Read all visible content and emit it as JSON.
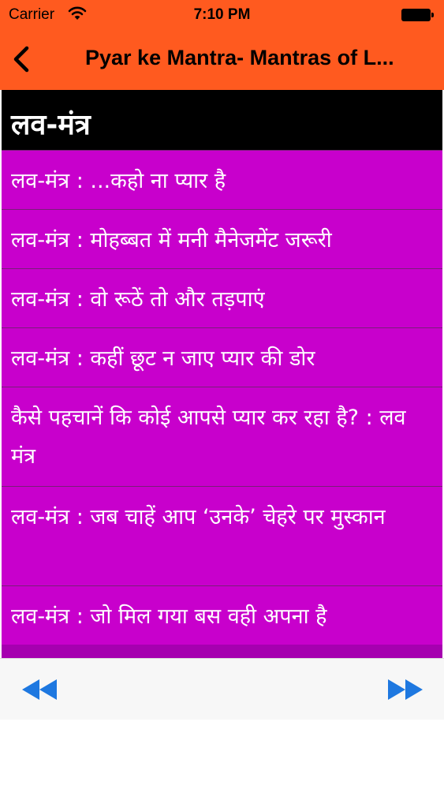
{
  "status_bar": {
    "carrier": "Carrier",
    "time": "7:10 PM",
    "wifi_icon": "wifi-icon",
    "battery_icon": "battery-icon"
  },
  "nav": {
    "title": "Pyar ke Mantra- Mantras of L...",
    "back_icon": "chevron-left-icon"
  },
  "section": {
    "header": "लव-मंत्र"
  },
  "items": [
    {
      "label": "लव-मंत्र : ...कहो ना प्यार है"
    },
    {
      "label": "लव-मंत्र : मोहब्बत में मनी मैनेजमेंट जरूरी"
    },
    {
      "label": "लव-मंत्र : वो रूठें तो और तड़पाएं"
    },
    {
      "label": "लव-मंत्र : कहीं छूट न जाए प्यार की डोर"
    },
    {
      "label": "कैसे पहचानें कि कोई आपसे प्यार कर रहा है? : लव मंत्र"
    },
    {
      "label": "लव-मंत्र : जब चाहें आप ‘उनके’ चेहरे पर मुस्कान"
    },
    {
      "label": "लव-मंत्र : जो मिल गया बस वही अपना है"
    }
  ],
  "bottom_bar": {
    "prev_icon": "rewind-icon",
    "next_icon": "fast-forward-icon"
  },
  "colors": {
    "nav_background": "#ff5a1f",
    "header_background": "#000000",
    "item_background": "#c800cc",
    "arrow_color": "#1e78e0"
  }
}
